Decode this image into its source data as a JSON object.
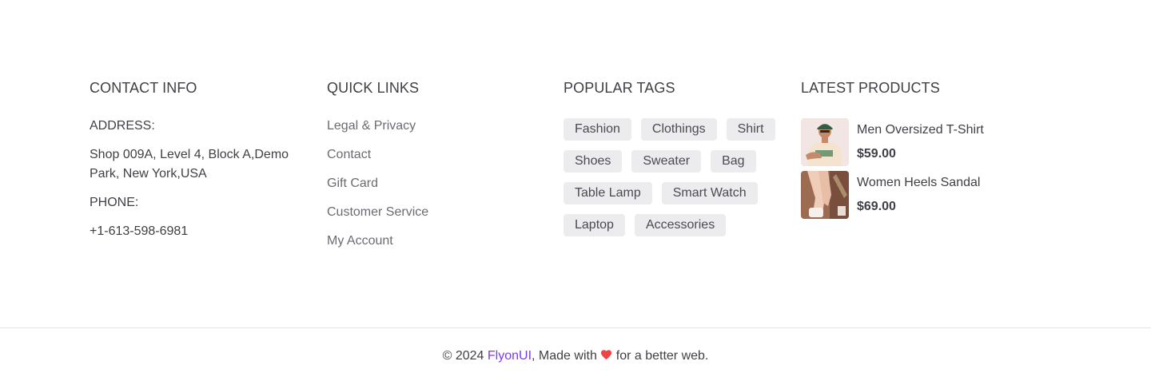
{
  "contact": {
    "title": "CONTACT INFO",
    "address_label": "ADDRESS:",
    "address": "Shop 009A, Level 4, Block A,Demo Park, New York,USA",
    "phone_label": "PHONE:",
    "phone": "+1-613-598-6981"
  },
  "quick_links": {
    "title": "QUICK LINKS",
    "items": [
      "Legal & Privacy",
      "Contact",
      "Gift Card",
      "Customer Service",
      "My Account"
    ]
  },
  "tags": {
    "title": "POPULAR TAGS",
    "rows": [
      [
        "Fashion",
        "Clothings",
        "Shirt"
      ],
      [
        "Shoes",
        "Sweater",
        "Bag"
      ],
      [
        "Table Lamp",
        "Smart Watch"
      ],
      [
        "Laptop",
        "Accessories"
      ]
    ]
  },
  "products": {
    "title": "LATEST PRODUCTS",
    "items": [
      {
        "name": "Men Oversized T-Shirt",
        "price": "$59.00"
      },
      {
        "name": "Women Heels Sandal",
        "price": "$69.00"
      }
    ]
  },
  "footer": {
    "prefix": "© 2024",
    "brand": "FlyonUI",
    "made_with": ", Made with",
    "heart_icon": "heart-icon",
    "suffix": "for a better web.",
    "brand_color": "#7c3aed",
    "heart_color": "#ef4444"
  }
}
